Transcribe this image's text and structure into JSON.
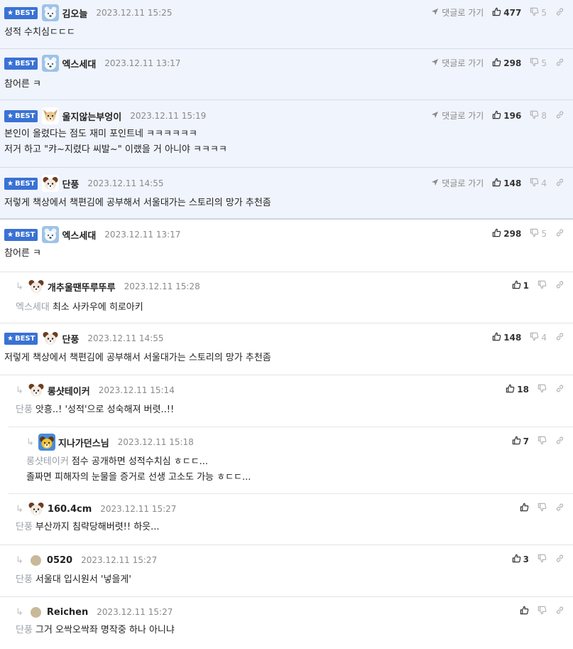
{
  "labels": {
    "best": "BEST",
    "goto_reply": "댓글로 가기"
  },
  "colors": {
    "best_badge": "#3a72d4",
    "best_bg": "#f0f4fc",
    "reply_ref": "#9aa0a8"
  },
  "best_comments": [
    {
      "author": "김오늘",
      "date": "2023.12.11 15:25",
      "lines": [
        "성적 수치심ㄷㄷㄷ"
      ],
      "up": "477",
      "down": "5",
      "avatar": "polar-bear"
    },
    {
      "author": "엑스세대",
      "date": "2023.12.11 13:17",
      "lines": [
        "참어른 ㅋ"
      ],
      "up": "298",
      "down": "5",
      "avatar": "polar-bear"
    },
    {
      "author": "울지않는부엉이",
      "date": "2023.12.11 15:19",
      "lines": [
        "본인이 올렸다는 점도 재미 포인트네 ㅋㅋㅋㅋㅋㅋ",
        "저거 하고 \"캬~지렸다 씨발~\" 이랬을 거 아니야 ㅋㅋㅋㅋ"
      ],
      "up": "196",
      "down": "8",
      "avatar": "chihuahua"
    },
    {
      "author": "단풍",
      "date": "2023.12.11 14:55",
      "lines": [
        "저렇게 책상에서 책편김에 공부해서 서울대가는 스토리의 망가 추천좀"
      ],
      "up": "148",
      "down": "4",
      "avatar": "dog"
    }
  ],
  "comments": [
    {
      "author": "엑스세대",
      "date": "2023.12.11 13:17",
      "lines": [
        "참어른 ㅋ"
      ],
      "up": "298",
      "down": "5",
      "best": true,
      "avatar": "polar-bear"
    },
    {
      "author": "개추울땐뚜루뚜루",
      "date": "2023.12.11 15:28",
      "ref": "엑스세대",
      "lines": [
        "최소 사카우에 히로아키"
      ],
      "up": "1",
      "down": "",
      "avatar": "dog"
    },
    {
      "author": "단풍",
      "date": "2023.12.11 14:55",
      "lines": [
        "저렇게 책상에서 책편김에 공부해서 서울대가는 스토리의 망가 추천좀"
      ],
      "up": "148",
      "down": "4",
      "best": true,
      "avatar": "dog"
    },
    {
      "author": "롱샷테이커",
      "date": "2023.12.11 15:14",
      "ref": "단풍",
      "lines": [
        "앗흥..! '성적'으로 성숙해져 버렷..!!"
      ],
      "up": "18",
      "down": "",
      "avatar": "dog"
    },
    {
      "author": "지나가던스님",
      "date": "2023.12.11 15:18",
      "ref": "롱샷테이커",
      "lines": [
        "점수 공개하면 성적수치심 ㅎㄷㄷ...",
        "졸짜면 피해자의 눈물을 증거로 선생 고소도 가능 ㅎㄷㄷ..."
      ],
      "up": "7",
      "down": "",
      "avatar": "dog-yellow"
    },
    {
      "author": "160.4cm",
      "date": "2023.12.11 15:27",
      "ref": "단풍",
      "lines": [
        "부산까지 침략당해버렷!! 하읏..."
      ],
      "up": "",
      "down": "",
      "avatar": "dog"
    },
    {
      "author": "0520",
      "date": "2023.12.11 15:27",
      "ref": "단풍",
      "lines": [
        "서울대 입시원서 '넣을게'"
      ],
      "up": "3",
      "down": "",
      "avatar": "dot"
    },
    {
      "author": "Reichen",
      "date": "2023.12.11 15:27",
      "ref": "단풍",
      "lines": [
        "그거 오싹오싹좌 명작중 하나 아니냐"
      ],
      "up": "",
      "down": "",
      "avatar": "dot"
    }
  ]
}
